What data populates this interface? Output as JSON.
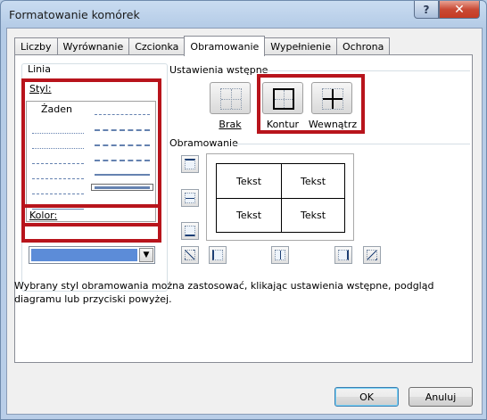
{
  "window": {
    "title": "Formatowanie komórek",
    "help": "?",
    "close": "✕"
  },
  "tabs": [
    "Liczby",
    "Wyrównanie",
    "Czcionka",
    "Obramowanie",
    "Wypełnienie",
    "Ochrona"
  ],
  "active_tab": "Obramowanie",
  "line": {
    "group_label": "Linia",
    "style_label": "Styl:",
    "none_label": "Żaden",
    "color_label": "Kolor:",
    "color_value": "#5c8cd8"
  },
  "presets": {
    "group_label": "Ustawienia wstępne",
    "items": [
      {
        "id": "none",
        "label": "Brak"
      },
      {
        "id": "outline",
        "label": "Kontur"
      },
      {
        "id": "inside",
        "label": "Wewnątrz"
      }
    ]
  },
  "border": {
    "group_label": "Obramowanie",
    "cells": [
      "Tekst",
      "Tekst",
      "Tekst",
      "Tekst"
    ]
  },
  "description": "Wybrany styl obramowania można zastosować, klikając ustawienia wstępne, podgląd diagramu lub przyciski powyżej.",
  "buttons": {
    "ok": "OK",
    "cancel": "Anuluj"
  },
  "colors": {
    "highlight": "#b8141c",
    "line": "#6582b0"
  }
}
